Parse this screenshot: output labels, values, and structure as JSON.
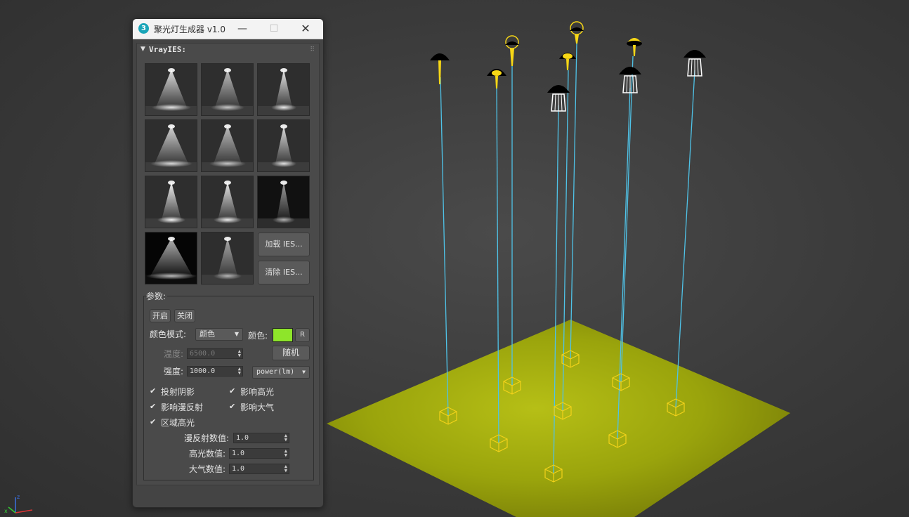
{
  "window": {
    "app_icon": "3",
    "title": "聚光灯生成器 v1.0",
    "min_glyph": "—",
    "max_glyph": "☐",
    "close_glyph": "✕"
  },
  "rollout": {
    "title": "VrayIES:",
    "arrow": "▼",
    "grip": "⠿"
  },
  "ies_buttons": {
    "load": "加载 IES...",
    "clear": "清除 IES..."
  },
  "params": {
    "group_label": "参数:",
    "on_label": "开启",
    "off_label": "关闭",
    "color_mode_label": "颜色模式:",
    "color_mode_value": "颜色",
    "color_label": "颜色:",
    "color_value": "#8ee52a",
    "reset_label": "R",
    "temperature_label": "温度:",
    "temperature_value": "6500.0",
    "random_label": "随机",
    "intensity_label": "强度:",
    "intensity_value": "1000.0",
    "intensity_unit": "power(lm)",
    "check_mark": "✔",
    "cast_shadows": "投射阴影",
    "affect_specular": "影响高光",
    "affect_diffuse": "影响漫反射",
    "affect_atmosphere": "影响大气",
    "area_specular": "区域高光",
    "diffuse_value_label": "漫反射数值:",
    "diffuse_value": "1.0",
    "specular_value_label": "高光数值:",
    "specular_value": "1.0",
    "atmosphere_value_label": "大气数值:",
    "atmosphere_value": "1.0"
  },
  "viewport": {
    "axis_x": "x",
    "axis_z": "z",
    "light_color": "#f7d716",
    "wire_color": "#4fc3e8",
    "plane_color": "#9fb00f"
  }
}
